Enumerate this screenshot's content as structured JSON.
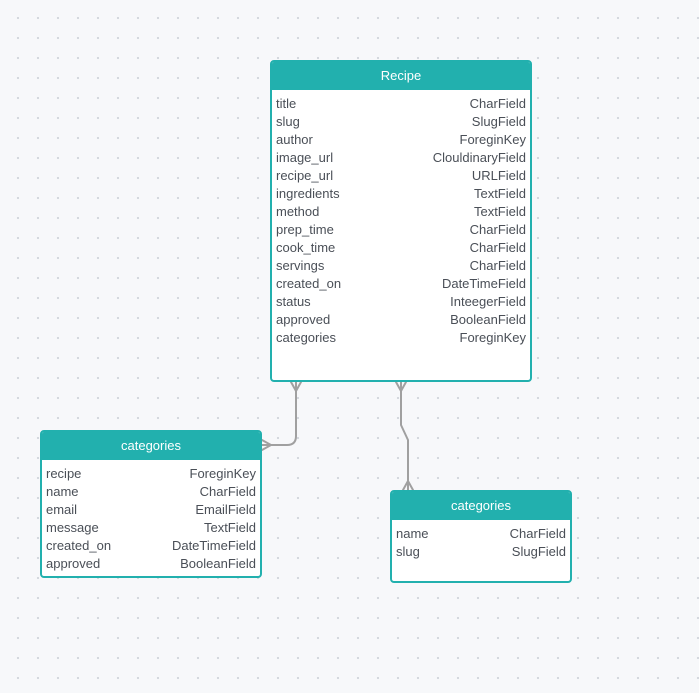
{
  "canvas": {
    "background": "#f7f8fa",
    "accent_color": "#22b0ae",
    "connector_color": "#a0a0a0"
  },
  "entities": {
    "recipe": {
      "title": "Recipe",
      "fields": [
        {
          "name": "title",
          "type": "CharField"
        },
        {
          "name": "slug",
          "type": "SlugField"
        },
        {
          "name": "author",
          "type": "ForeginKey"
        },
        {
          "name": "image_url",
          "type": "ClouldinaryField"
        },
        {
          "name": "recipe_url",
          "type": "URLField"
        },
        {
          "name": "ingredients",
          "type": "TextField"
        },
        {
          "name": "method",
          "type": "TextField"
        },
        {
          "name": "prep_time",
          "type": "CharField"
        },
        {
          "name": "cook_time",
          "type": "CharField"
        },
        {
          "name": "servings",
          "type": "CharField"
        },
        {
          "name": "created_on",
          "type": "DateTimeField"
        },
        {
          "name": "status",
          "type": "InteegerField"
        },
        {
          "name": "approved",
          "type": "BooleanField"
        },
        {
          "name": "categories",
          "type": "ForeginKey"
        }
      ]
    },
    "categories_left": {
      "title": "categories",
      "fields": [
        {
          "name": "recipe",
          "type": "ForeginKey"
        },
        {
          "name": "name",
          "type": "CharField"
        },
        {
          "name": "email",
          "type": "EmailField"
        },
        {
          "name": "message",
          "type": "TextField"
        },
        {
          "name": "created_on",
          "type": "DateTimeField"
        },
        {
          "name": "approved",
          "type": "BooleanField"
        }
      ]
    },
    "categories_right": {
      "title": "categories",
      "fields": [
        {
          "name": "name",
          "type": "CharField"
        },
        {
          "name": "slug",
          "type": "SlugField"
        }
      ]
    }
  },
  "relations": [
    {
      "from": "recipe",
      "to": "categories_left",
      "from_end": "many",
      "to_end": "many"
    },
    {
      "from": "recipe",
      "to": "categories_right",
      "from_end": "many",
      "to_end": "many"
    }
  ]
}
